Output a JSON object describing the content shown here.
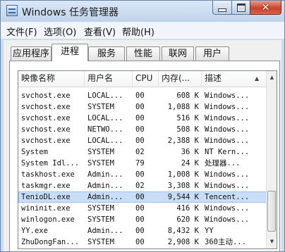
{
  "window": {
    "title": "Windows 任务管理器"
  },
  "menu": [
    {
      "label": "文件(F)"
    },
    {
      "label": "选项(O)"
    },
    {
      "label": "查看(V)"
    },
    {
      "label": "帮助(H)"
    }
  ],
  "tabs": [
    {
      "label": "应用程序"
    },
    {
      "label": "进程",
      "active": true
    },
    {
      "label": "服务"
    },
    {
      "label": "性能"
    },
    {
      "label": "联网"
    },
    {
      "label": "用户"
    }
  ],
  "columns": [
    "映像名称",
    "用户名",
    "CPU",
    "内存(...",
    "描述"
  ],
  "sort_indicator": "▲",
  "processes": [
    {
      "name": "svchost.exe",
      "user": "LOCAL...",
      "cpu": "00",
      "mem": "608 K",
      "desc": "Windows..."
    },
    {
      "name": "svchost.exe",
      "user": "SYSTEM",
      "cpu": "00",
      "mem": "1,088 K",
      "desc": "Windows..."
    },
    {
      "name": "svchost.exe",
      "user": "LOCAL...",
      "cpu": "00",
      "mem": "516 K",
      "desc": "Windows..."
    },
    {
      "name": "svchost.exe",
      "user": "NETWO...",
      "cpu": "00",
      "mem": "508 K",
      "desc": "Windows..."
    },
    {
      "name": "svchost.exe",
      "user": "LOCAL...",
      "cpu": "00",
      "mem": "2,388 K",
      "desc": "Windows..."
    },
    {
      "name": "System",
      "user": "SYSTEM",
      "cpu": "02",
      "mem": "36 K",
      "desc": "NT Kern..."
    },
    {
      "name": "System Idl...",
      "user": "SYSTEM",
      "cpu": "79",
      "mem": "24 K",
      "desc": "处理器..."
    },
    {
      "name": "taskhost.exe",
      "user": "Admin...",
      "cpu": "00",
      "mem": "1,008 K",
      "desc": "Windows..."
    },
    {
      "name": "taskmgr.exe",
      "user": "Admin...",
      "cpu": "02",
      "mem": "3,308 K",
      "desc": "Windows..."
    },
    {
      "name": "TenioDL.exe",
      "user": "Admin...",
      "cpu": "00",
      "mem": "9,544 K",
      "desc": "Tencent...",
      "selected": true
    },
    {
      "name": "wininit.exe",
      "user": "SYSTEM",
      "cpu": "00",
      "mem": "416 K",
      "desc": "Windows..."
    },
    {
      "name": "winlogon.exe",
      "user": "SYSTEM",
      "cpu": "00",
      "mem": "620 K",
      "desc": "Windows..."
    },
    {
      "name": "YY.exe",
      "user": "Admin...",
      "cpu": "00",
      "mem": "8,432 K",
      "desc": "YY"
    },
    {
      "name": "ZhuDongFan...",
      "user": "SYSTEM",
      "cpu": "00",
      "mem": "2,908 K",
      "desc": "360主动..."
    }
  ],
  "colors": {
    "selection": "#c9def6",
    "close_button": "#c9412b"
  }
}
